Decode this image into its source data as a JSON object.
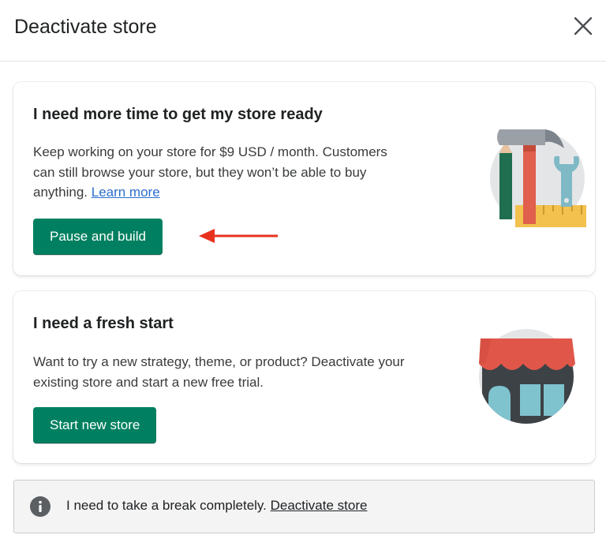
{
  "header": {
    "title": "Deactivate store",
    "close_icon": "close-icon"
  },
  "pause_card": {
    "heading": "I need more time to get my store ready",
    "body": "Keep working on your store for $9 USD / month. Customers can still browse your store, but they won’t be able to buy anything.",
    "learn_more": "Learn more",
    "button_label": "Pause and build",
    "illustration": "tools-illustration"
  },
  "fresh_card": {
    "heading": "I need a fresh start",
    "body": "Want to try a new strategy, theme, or product? Deactivate your existing store and start a new free trial.",
    "button_label": "Start new store",
    "illustration": "storefront-illustration"
  },
  "break_banner": {
    "icon": "info-icon",
    "text": "I need to take a break completely.",
    "link": "Deactivate store"
  },
  "annotation": {
    "arrow": "red-arrow-pointing-left"
  },
  "colors": {
    "primary_button": "#008060",
    "link": "#2c6ecb",
    "arrow": "#e8321e"
  }
}
